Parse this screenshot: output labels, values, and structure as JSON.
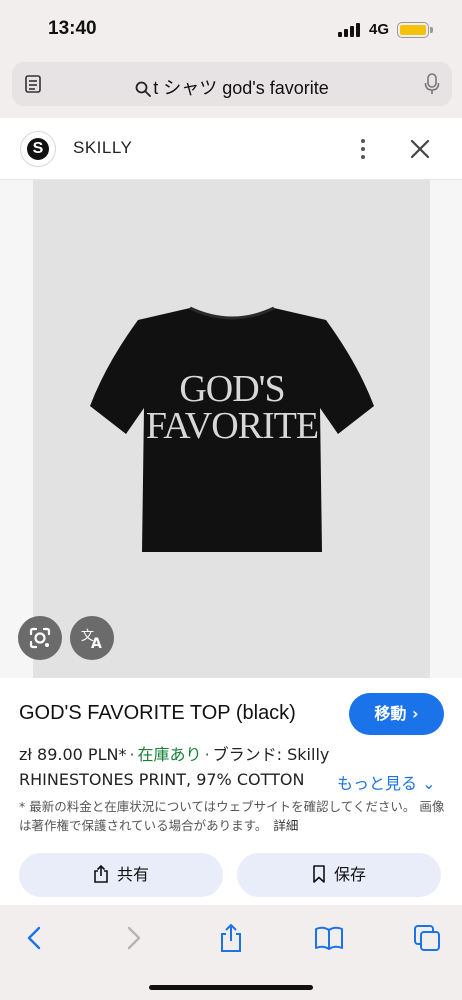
{
  "status_bar": {
    "time": "13:40",
    "network": "4G",
    "battery_level": 1.0,
    "battery_color": "#f4c20d"
  },
  "address_bar": {
    "query": "t シャツ god's favorite",
    "left_icon": "page-menu-icon",
    "right_icon": "mic-icon"
  },
  "panel": {
    "site_name": "SKILLY",
    "logo_letter": "S"
  },
  "image": {
    "print_line1": "GOD'S",
    "print_line2": "FAVORITE",
    "lens_icon": "lens-icon",
    "translate_icon": "translate-icon"
  },
  "product": {
    "title": "GOD'S FAVORITE TOP (black)",
    "visit_label": "移動 ›",
    "price": "zł 89.00 PLN*",
    "stock": "在庫あり",
    "brand": "ブランド: Skilly",
    "description": "RHINESTONES PRINT, 97% COTTON",
    "see_more": "もっと見る ⌄",
    "disclaimer": "* 最新の料金と在庫状況についてはウェブサイトを確認してください。 画像は著作権で保護されている場合があります。",
    "details_link": "詳細",
    "share_label": "共有",
    "save_label": "保存"
  },
  "colors": {
    "accent": "#1a73e8",
    "stock_green": "#188038",
    "pill_bg": "#e8edf9",
    "chrome_bg": "#f3eeee"
  }
}
